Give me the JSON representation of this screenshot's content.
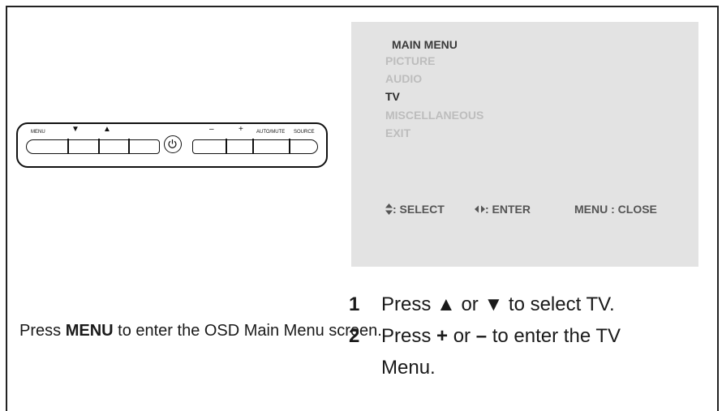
{
  "control_panel": {
    "menu_label": "MENU",
    "down_label": "▼",
    "up_label": "▲",
    "power_icon": "power-icon",
    "minus_label": "–",
    "plus_label": "+",
    "automute_label": "AUTO/MUTE",
    "source_label": "SOURCE"
  },
  "osd": {
    "title": "MAIN MENU",
    "items": [
      "PICTURE",
      "AUDIO",
      "TV",
      "MISCELLANEOUS",
      "EXIT"
    ],
    "active_item": "TV",
    "hints": {
      "select": ": SELECT",
      "enter": ": ENTER",
      "close": "MENU : CLOSE"
    },
    "colors": {
      "background": "#e3e3e3",
      "inactive": "#bdbdbd",
      "active": "#2a2a2a"
    }
  },
  "instructions": {
    "left_prefix": "Press ",
    "left_bold": "MENU",
    "left_suffix": " to enter the OSD Main Menu screen.",
    "step1_num": "1",
    "step1_a": "Press ",
    "step1_up": "▲",
    "step1_b": " or ",
    "step1_down": "▼",
    "step1_c": " to select TV.",
    "step2_num": "2",
    "step2_a": "Press ",
    "step2_plus": "+",
    "step2_b": " or ",
    "step2_minus": "–",
    "step2_c": " to enter the TV",
    "step2_cont": "Menu."
  }
}
